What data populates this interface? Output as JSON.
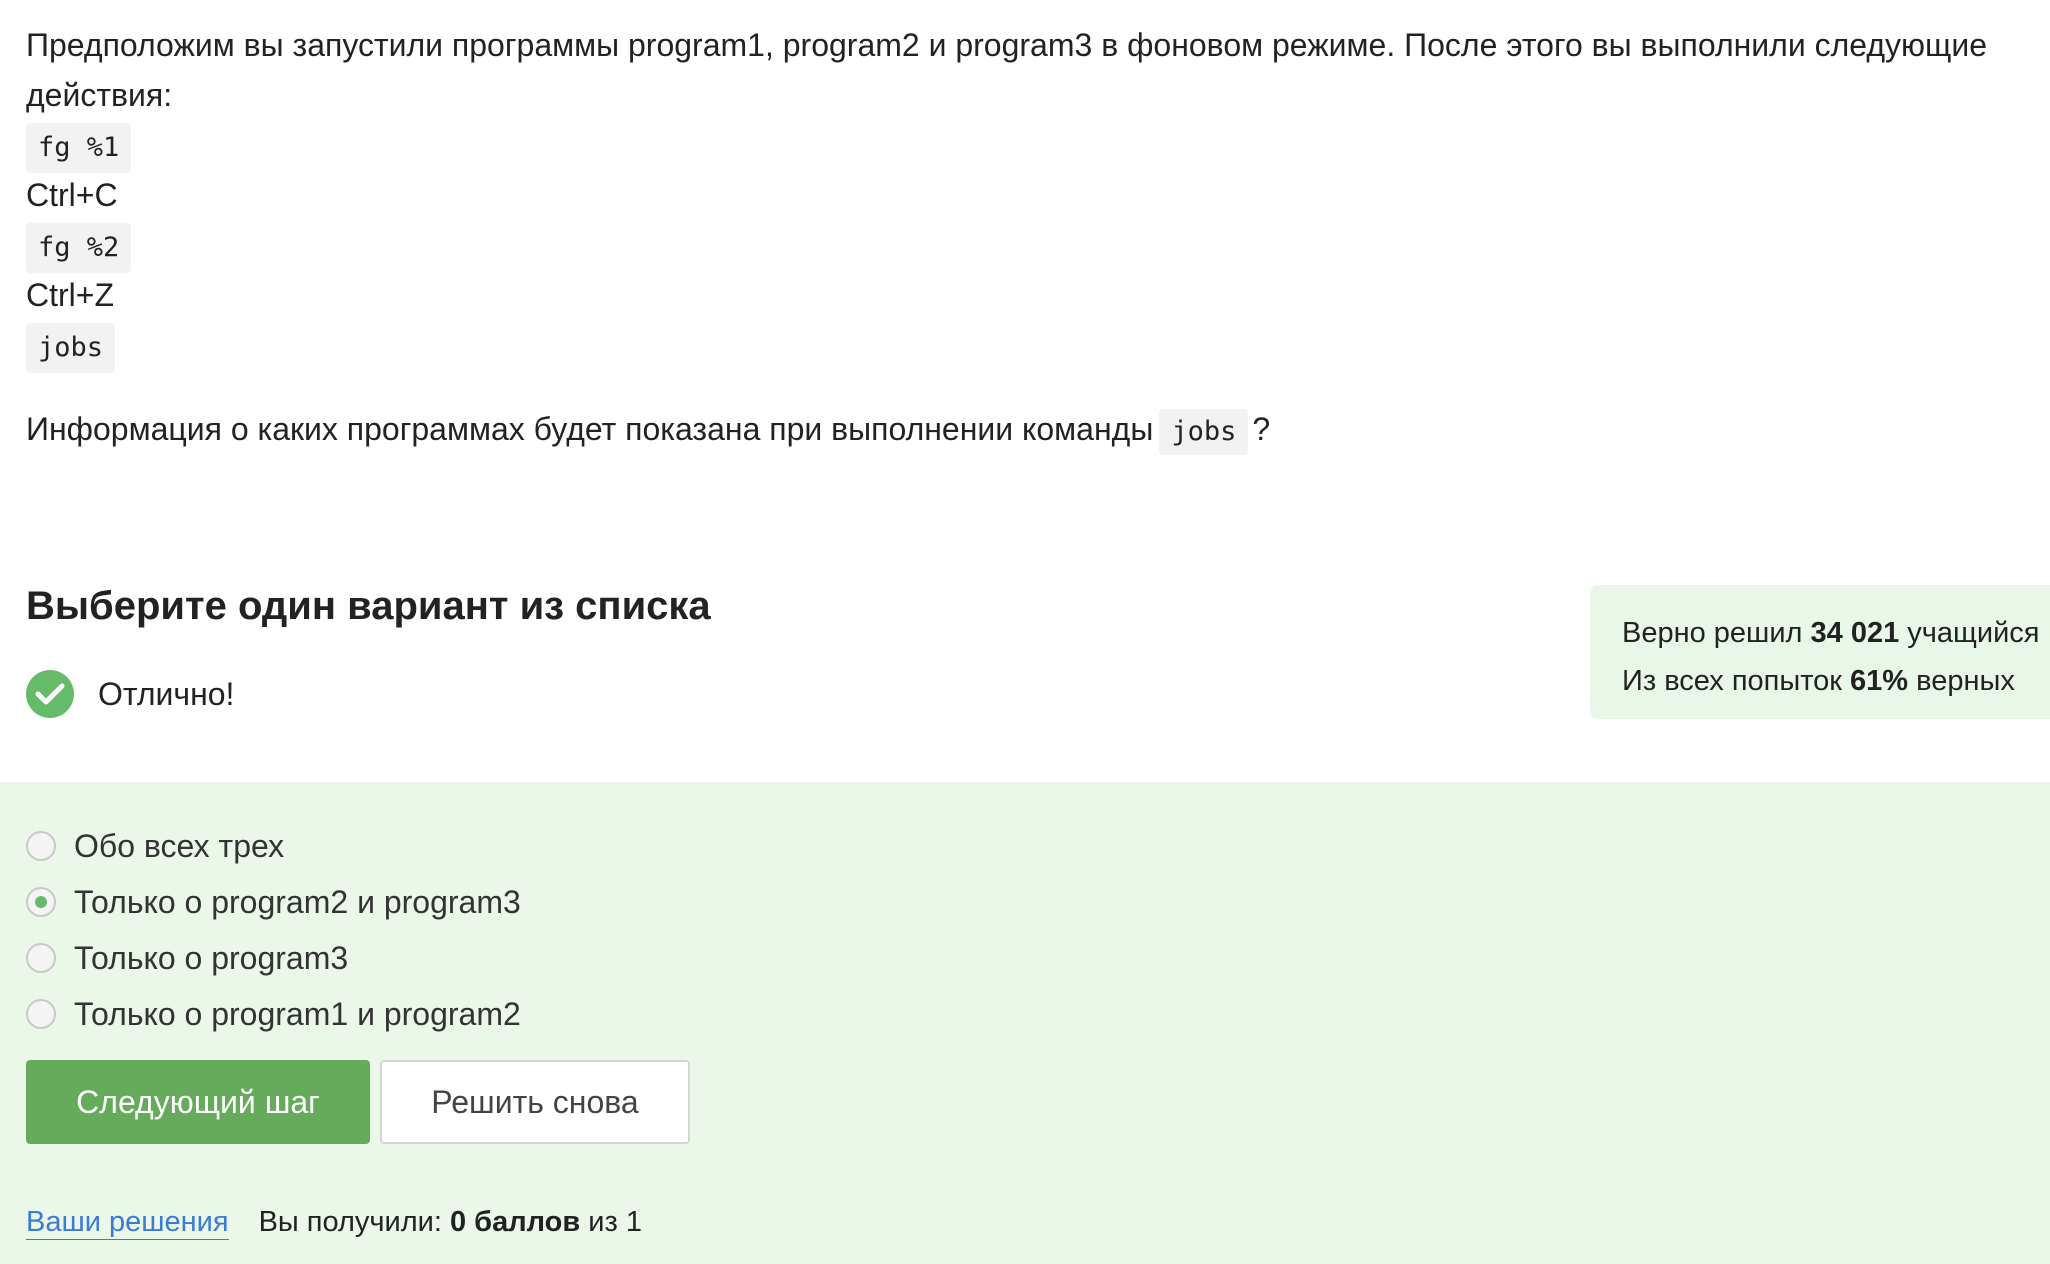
{
  "question": {
    "intro": "Предположим вы запустили программы program1, program2 и program3 в фоновом режиме. После этого вы выполнили следующие действия:",
    "steps": [
      {
        "type": "code",
        "text": "fg %1"
      },
      {
        "type": "text",
        "text": "Ctrl+C"
      },
      {
        "type": "code",
        "text": "fg %2"
      },
      {
        "type": "text",
        "text": "Ctrl+Z"
      },
      {
        "type": "code",
        "text": "jobs"
      }
    ],
    "ask_before": "Информация о каких программах будет показана при выполнении команды",
    "ask_code": "jobs",
    "ask_after": "?"
  },
  "section_title": "Выберите один вариант из списка",
  "result": {
    "icon": "check-icon",
    "text": "Отлично!"
  },
  "stats": {
    "solved_prefix": "Верно решил",
    "solved_count": "34 021",
    "solved_suffix": "учащийся",
    "attempts_prefix": "Из всех попыток",
    "attempts_percent": "61%",
    "attempts_suffix": "верных"
  },
  "options": [
    {
      "label": "Обо всех трех",
      "selected": false
    },
    {
      "label": "Только о program2 и program3",
      "selected": true
    },
    {
      "label": "Только о program3",
      "selected": false
    },
    {
      "label": "Только о program1 и program2",
      "selected": false
    }
  ],
  "buttons": {
    "next_label": "Следующий шаг",
    "retry_label": "Решить снова"
  },
  "footer": {
    "solutions_link": "Ваши решения",
    "score_prefix": "Вы получили:",
    "score_value": "0 баллов",
    "score_suffix": "из 1"
  },
  "colors": {
    "accent_green": "#66aa5c",
    "answers_bg": "#eaf7e9",
    "link_blue": "#3a7bd5"
  }
}
